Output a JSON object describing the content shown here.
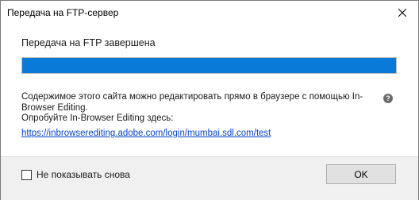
{
  "window": {
    "title": "Передача на FTP-сервер",
    "close_glyph": "✕"
  },
  "status": {
    "text": "Передача на FTP завершена",
    "progress_percent": 100,
    "progress_color": "#0a7ad9"
  },
  "info": {
    "description": "Содержимое этого сайта можно редактировать прямо в браузере с помощью In-Browser Editing.",
    "help_glyph": "?",
    "try_text": "Опробуйте In-Browser Editing здесь:",
    "link": "https://inbrowserediting.adobe.com/login/mumbai.sdl.com/test"
  },
  "footer": {
    "checkbox_label": "Не показывать снова",
    "checkbox_checked": false,
    "ok_label": "OK"
  }
}
